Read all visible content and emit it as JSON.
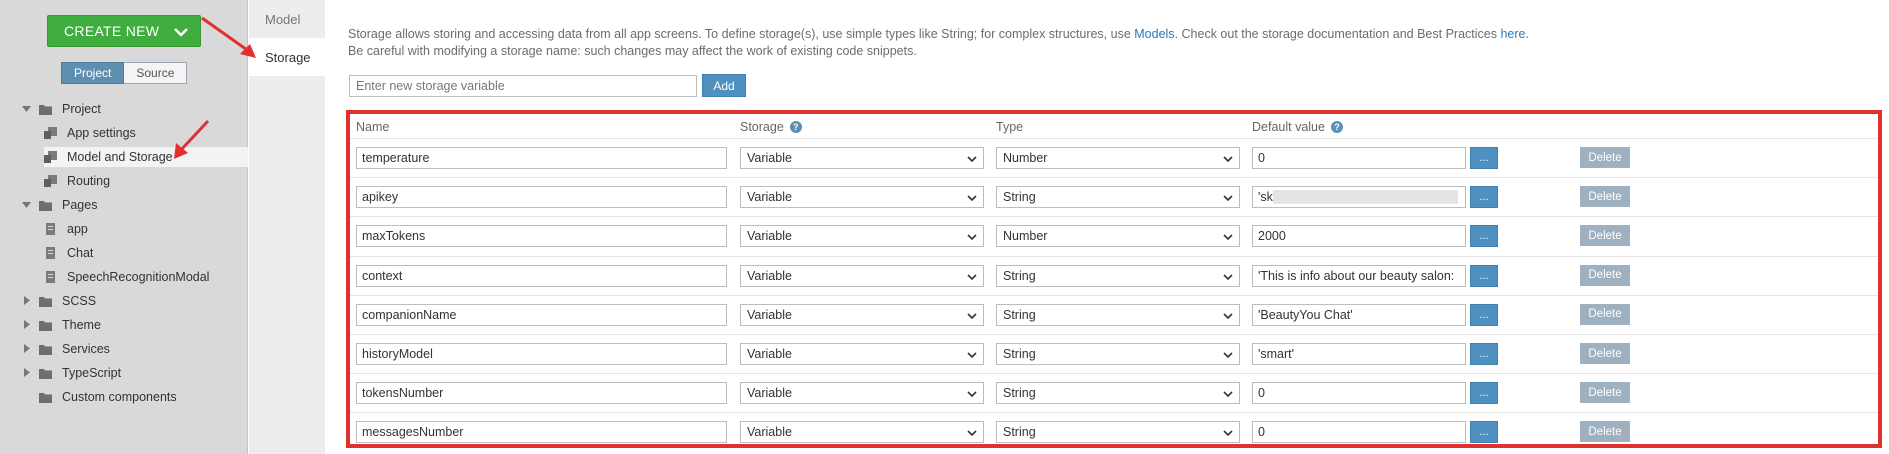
{
  "sidebar": {
    "create_new": "CREATE NEW",
    "toggle": {
      "project": "Project",
      "source": "Source"
    },
    "tree": [
      {
        "label": "Project",
        "caret": "down",
        "icon": "folder-icon",
        "level": 0
      },
      {
        "label": "App settings",
        "caret": "",
        "icon": "settings-page-icon",
        "level": 1
      },
      {
        "label": "Model and Storage",
        "caret": "",
        "icon": "model-page-icon",
        "level": 1,
        "selected": true
      },
      {
        "label": "Routing",
        "caret": "",
        "icon": "routing-page-icon",
        "level": 1
      },
      {
        "label": "Pages",
        "caret": "down",
        "icon": "folder-icon",
        "level": 0
      },
      {
        "label": "app",
        "caret": "",
        "icon": "page-icon",
        "level": 1
      },
      {
        "label": "Chat",
        "caret": "",
        "icon": "page-icon",
        "level": 1
      },
      {
        "label": "SpeechRecognitionModal",
        "caret": "",
        "icon": "page-icon",
        "level": 1
      },
      {
        "label": "SCSS",
        "caret": "right",
        "icon": "folder-icon",
        "level": 0
      },
      {
        "label": "Theme",
        "caret": "right",
        "icon": "folder-icon",
        "level": 0
      },
      {
        "label": "Services",
        "caret": "right",
        "icon": "folder-icon",
        "level": 0
      },
      {
        "label": "TypeScript",
        "caret": "right",
        "icon": "folder-icon",
        "level": 0
      },
      {
        "label": "Custom components",
        "caret": "",
        "icon": "folder-icon",
        "level": 0
      }
    ]
  },
  "subnav": {
    "model": "Model",
    "storage": "Storage"
  },
  "info": {
    "line1_a": "Storage allows storing and accessing data from all app screens. To define storage(s), use simple types like String; for complex structures, use ",
    "models_link": "Models",
    "line1_b": ". Check out the storage documentation and Best Practices ",
    "here_link": "here",
    "line1_c": ".",
    "line2": "Be careful with modifying a storage name: such changes may affect the work of existing code snippets."
  },
  "new_var": {
    "placeholder": "Enter new storage variable",
    "add_label": "Add"
  },
  "table": {
    "headers": {
      "name": "Name",
      "storage": "Storage",
      "type": "Type",
      "default": "Default value"
    },
    "dots_label": "...",
    "delete_label": "Delete",
    "rows": [
      {
        "name": "temperature",
        "storage": "Variable",
        "type": "Number",
        "default": "0"
      },
      {
        "name": "apikey",
        "storage": "Variable",
        "type": "String",
        "default": "'sk-                                                           n",
        "redacted": true
      },
      {
        "name": "maxTokens",
        "storage": "Variable",
        "type": "Number",
        "default": "2000"
      },
      {
        "name": "context",
        "storage": "Variable",
        "type": "String",
        "default": "'This is info about our beauty salon:   Service"
      },
      {
        "name": "companionName",
        "storage": "Variable",
        "type": "String",
        "default": "'BeautyYou Chat'"
      },
      {
        "name": "historyModel",
        "storage": "Variable",
        "type": "String",
        "default": "'smart'"
      },
      {
        "name": "tokensNumber",
        "storage": "Variable",
        "type": "String",
        "default": "0"
      },
      {
        "name": "messagesNumber",
        "storage": "Variable",
        "type": "String",
        "default": "0"
      }
    ]
  },
  "colors": {
    "create_green": "#3fae3f",
    "accent_blue": "#4e90c0",
    "annotation_red": "#e03030"
  }
}
